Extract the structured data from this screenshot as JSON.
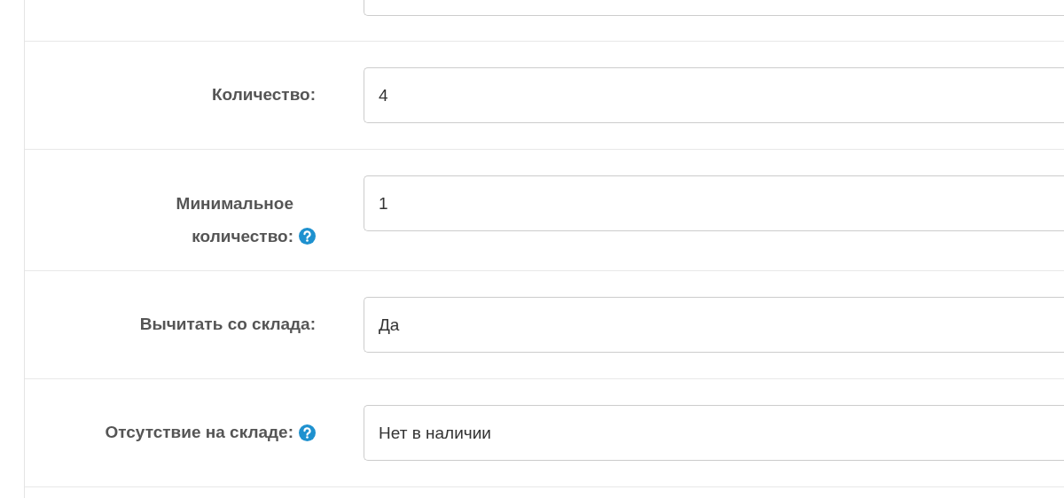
{
  "fields": [
    {
      "label": "Количество:",
      "value": "4",
      "help": false
    },
    {
      "label": "Минимальное количество:",
      "value": "1",
      "help": true
    },
    {
      "label": "Вычитать со склада:",
      "value": "Да",
      "help": false
    },
    {
      "label": "Отсутствие на складе:",
      "value": "Нет в наличии",
      "help": true
    }
  ]
}
